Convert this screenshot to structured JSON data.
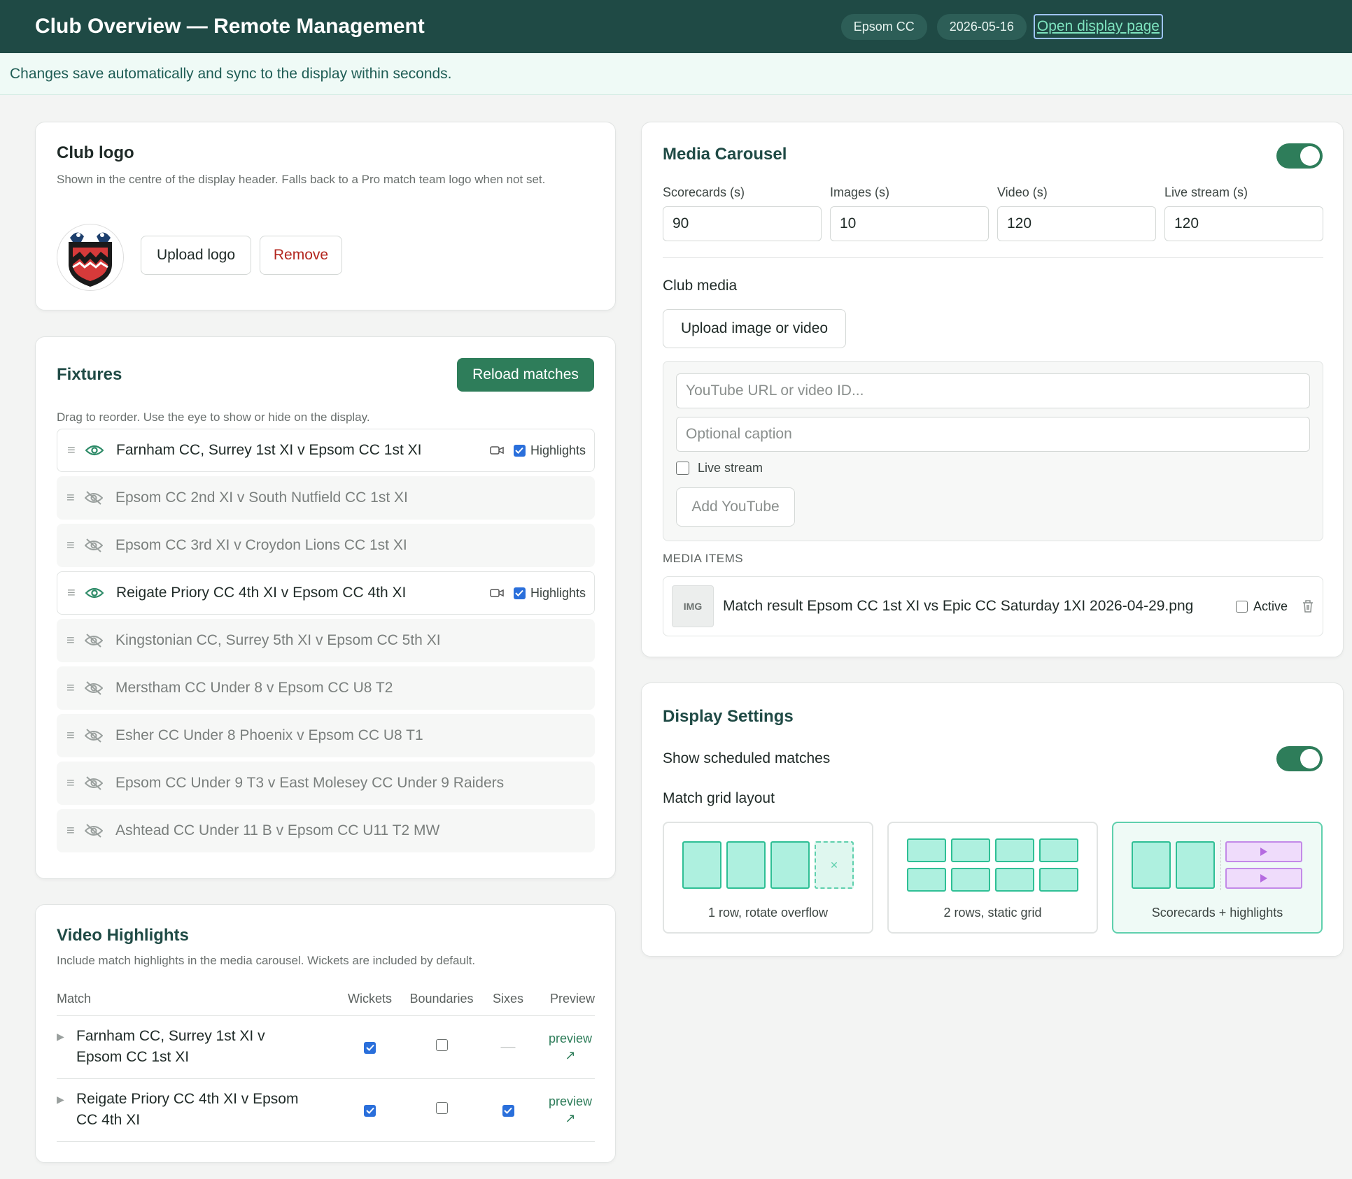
{
  "header": {
    "title": "Club Overview — Remote Management",
    "club": "Epsom CC",
    "date": "2026-05-16",
    "open_display": "Open display page"
  },
  "banner": "Changes save automatically and sync to the display within seconds.",
  "logo_card": {
    "title": "Club logo",
    "description": "Shown in the centre of the display header. Falls back to a Pro match team logo when not set.",
    "upload": "Upload logo",
    "remove": "Remove"
  },
  "fixtures": {
    "title": "Fixtures",
    "reload": "Reload matches",
    "hint": "Drag to reorder. Use the eye to show or hide on the display.",
    "highlights_label": "Highlights",
    "items": [
      {
        "name": "Farnham CC, Surrey 1st XI v Epsom CC 1st XI",
        "visible": true,
        "highlights": true
      },
      {
        "name": "Epsom CC 2nd XI v South Nutfield CC 1st XI",
        "visible": false
      },
      {
        "name": "Epsom CC 3rd XI v Croydon Lions CC 1st XI",
        "visible": false
      },
      {
        "name": "Reigate Priory CC 4th XI v Epsom CC 4th XI",
        "visible": true,
        "highlights": true
      },
      {
        "name": "Kingstonian CC, Surrey 5th XI v Epsom CC 5th XI",
        "visible": false
      },
      {
        "name": "Merstham CC Under 8 v Epsom CC U8 T2",
        "visible": false
      },
      {
        "name": "Esher CC Under 8 Phoenix v Epsom CC U8 T1",
        "visible": false
      },
      {
        "name": "Epsom CC Under 9 T3 v East Molesey CC Under 9 Raiders",
        "visible": false
      },
      {
        "name": "Ashtead CC Under 11 B v Epsom CC U11 T2 MW",
        "visible": false
      }
    ]
  },
  "video_highlights": {
    "title": "Video Highlights",
    "description": "Include match highlights in the media carousel. Wickets are included by default.",
    "columns": [
      "Match",
      "Wickets",
      "Boundaries",
      "Sixes",
      "Preview"
    ],
    "preview_label": "preview",
    "preview_arrow": "↗",
    "rows": [
      {
        "match_line1": "Farnham CC, Surrey 1st XI v",
        "match_line2": "Epsom CC 1st XI",
        "wickets": true,
        "boundaries": false,
        "sixes": null,
        "sixes_text": "—"
      },
      {
        "match_line1": "Reigate Priory CC 4th XI v Epsom",
        "match_line2": "CC 4th XI",
        "wickets": true,
        "boundaries": false,
        "sixes": true
      }
    ]
  },
  "media_carousel": {
    "title": "Media Carousel",
    "enabled": true,
    "fields": [
      {
        "label": "Scorecards (s)",
        "value": "90"
      },
      {
        "label": "Images (s)",
        "value": "10"
      },
      {
        "label": "Video (s)",
        "value": "120"
      },
      {
        "label": "Live stream (s)",
        "value": "120"
      }
    ],
    "club_media_label": "Club media",
    "upload": "Upload image or video",
    "youtube_placeholder": "YouTube URL or video ID...",
    "caption_placeholder": "Optional caption",
    "live_stream_label": "Live stream",
    "add_youtube": "Add YouTube",
    "items_heading": "MEDIA ITEMS",
    "items": [
      {
        "thumb": "IMG",
        "name": "Match result Epsom CC 1st XI vs Epic CC Saturday 1XI 2026-04-29.png",
        "active_label": "Active",
        "active": false
      }
    ]
  },
  "display_settings": {
    "title": "Display Settings",
    "show_scheduled_label": "Show scheduled matches",
    "show_scheduled": true,
    "grid_layout_label": "Match grid layout",
    "layouts": [
      {
        "label": "1 row, rotate overflow",
        "selected": false
      },
      {
        "label": "2 rows, static grid",
        "selected": false
      },
      {
        "label": "Scorecards + highlights",
        "selected": true
      }
    ]
  },
  "colors": {
    "header_bg": "#1f4a45",
    "accent": "#2e7d5a",
    "checkbox": "#2a6fdb"
  }
}
